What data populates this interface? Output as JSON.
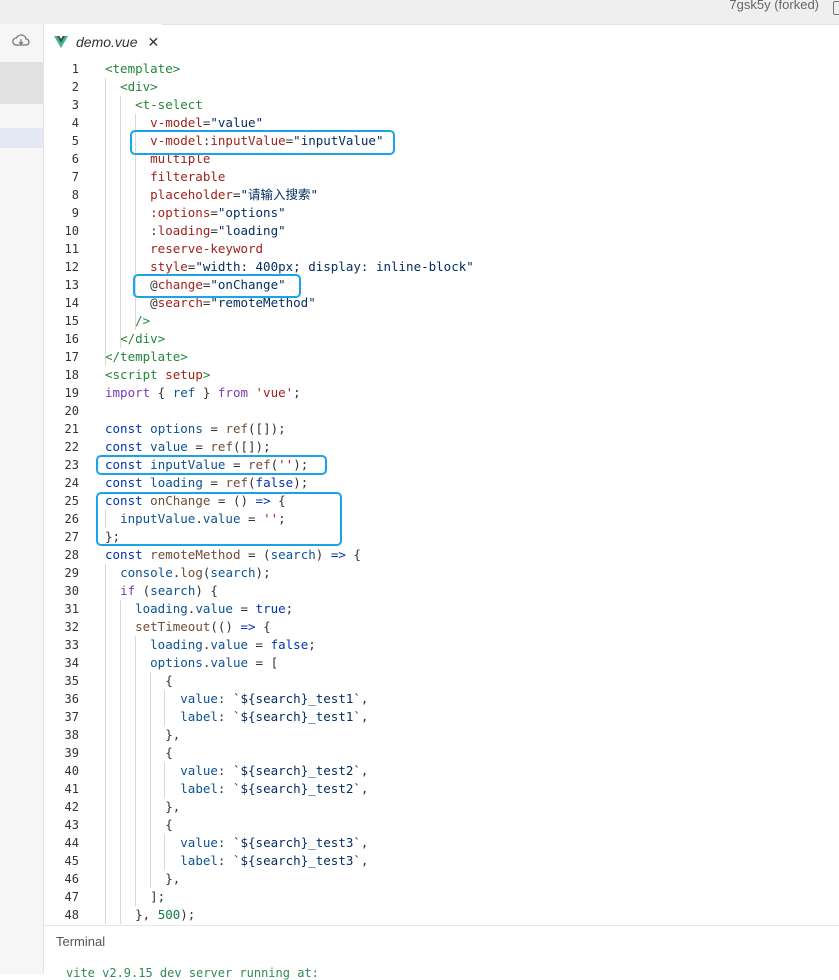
{
  "window": {
    "title": "7gsk5y (forked)"
  },
  "sidebar": {
    "sync_icon": "cloud-sync-icon"
  },
  "tab": {
    "label": "demo.vue",
    "close_label": "✕",
    "icon": "vue-logo-icon"
  },
  "editor": {
    "lines": [
      [
        {
          "t": "<template>",
          "c": "t-tag"
        }
      ],
      [
        {
          "t": "  "
        },
        {
          "t": "<div>",
          "c": "t-tag"
        }
      ],
      [
        {
          "t": "    "
        },
        {
          "t": "<t-select",
          "c": "t-tag"
        }
      ],
      [
        {
          "t": "      "
        },
        {
          "t": "v-model",
          "c": "t-attr"
        },
        {
          "t": "="
        },
        {
          "t": "\"value\"",
          "c": "t-str"
        }
      ],
      [
        {
          "t": "      "
        },
        {
          "t": "v-model",
          "c": "t-attr"
        },
        {
          "t": ":"
        },
        {
          "t": "inputValue",
          "c": "t-attr"
        },
        {
          "t": "="
        },
        {
          "t": "\"inputValue\"",
          "c": "t-str"
        }
      ],
      [
        {
          "t": "      "
        },
        {
          "t": "multiple",
          "c": "t-attr"
        }
      ],
      [
        {
          "t": "      "
        },
        {
          "t": "filterable",
          "c": "t-attr"
        }
      ],
      [
        {
          "t": "      "
        },
        {
          "t": "placeholder",
          "c": "t-attr"
        },
        {
          "t": "="
        },
        {
          "t": "\"请输入搜索\"",
          "c": "t-str"
        }
      ],
      [
        {
          "t": "      "
        },
        {
          "t": ":options",
          "c": "t-attr"
        },
        {
          "t": "="
        },
        {
          "t": "\"options\"",
          "c": "t-str"
        }
      ],
      [
        {
          "t": "      "
        },
        {
          "t": ":"
        },
        {
          "t": "loading",
          "c": "t-attr"
        },
        {
          "t": "="
        },
        {
          "t": "\"loading\"",
          "c": "t-str"
        }
      ],
      [
        {
          "t": "      "
        },
        {
          "t": "reserve-keyword",
          "c": "t-attr"
        }
      ],
      [
        {
          "t": "      "
        },
        {
          "t": "style",
          "c": "t-attr"
        },
        {
          "t": "="
        },
        {
          "t": "\"width: 400px; display: inline-block\"",
          "c": "t-str"
        }
      ],
      [
        {
          "t": "      "
        },
        {
          "t": "@"
        },
        {
          "t": "change",
          "c": "t-attr"
        },
        {
          "t": "="
        },
        {
          "t": "\"onChange\"",
          "c": "t-str"
        }
      ],
      [
        {
          "t": "      "
        },
        {
          "t": "@"
        },
        {
          "t": "search",
          "c": "t-attr"
        },
        {
          "t": "="
        },
        {
          "t": "\"remoteMethod\"",
          "c": "t-str"
        }
      ],
      [
        {
          "t": "    "
        },
        {
          "t": "/>",
          "c": "t-tag"
        }
      ],
      [
        {
          "t": "  "
        },
        {
          "t": "</div>",
          "c": "t-tag"
        }
      ],
      [
        {
          "t": "</template>",
          "c": "t-tag"
        }
      ],
      [
        {
          "t": "<script",
          "c": "t-tag"
        },
        {
          "t": " "
        },
        {
          "t": "setup",
          "c": "t-attr"
        },
        {
          "t": ">",
          "c": "t-tag"
        }
      ],
      [
        {
          "t": "import",
          "c": "t-kw2"
        },
        {
          "t": " { "
        },
        {
          "t": "ref",
          "c": "t-var"
        },
        {
          "t": " } "
        },
        {
          "t": "from",
          "c": "t-kw2"
        },
        {
          "t": " "
        },
        {
          "t": "'vue'",
          "c": "t-attr"
        },
        {
          "t": ";"
        }
      ],
      [],
      [
        {
          "t": "const",
          "c": "t-kw"
        },
        {
          "t": " "
        },
        {
          "t": "options",
          "c": "t-var"
        },
        {
          "t": " = "
        },
        {
          "t": "ref",
          "c": "t-fn"
        },
        {
          "t": "([]);"
        }
      ],
      [
        {
          "t": "const",
          "c": "t-kw"
        },
        {
          "t": " "
        },
        {
          "t": "value",
          "c": "t-var"
        },
        {
          "t": " = "
        },
        {
          "t": "ref",
          "c": "t-fn"
        },
        {
          "t": "([]);"
        }
      ],
      [
        {
          "t": "const",
          "c": "t-kw"
        },
        {
          "t": " "
        },
        {
          "t": "inputValue",
          "c": "t-var"
        },
        {
          "t": " = "
        },
        {
          "t": "ref",
          "c": "t-fn"
        },
        {
          "t": "("
        },
        {
          "t": "''",
          "c": "t-attr"
        },
        {
          "t": ");"
        }
      ],
      [
        {
          "t": "const",
          "c": "t-kw"
        },
        {
          "t": " "
        },
        {
          "t": "loading",
          "c": "t-var"
        },
        {
          "t": " = "
        },
        {
          "t": "ref",
          "c": "t-fn"
        },
        {
          "t": "("
        },
        {
          "t": "false",
          "c": "t-kw"
        },
        {
          "t": ");"
        }
      ],
      [
        {
          "t": "const",
          "c": "t-kw"
        },
        {
          "t": " "
        },
        {
          "t": "onChange",
          "c": "t-fn"
        },
        {
          "t": " = () "
        },
        {
          "t": "=>",
          "c": "t-kw"
        },
        {
          "t": " {"
        }
      ],
      [
        {
          "t": "  "
        },
        {
          "t": "inputValue",
          "c": "t-var"
        },
        {
          "t": "."
        },
        {
          "t": "value",
          "c": "t-var"
        },
        {
          "t": " = "
        },
        {
          "t": "''",
          "c": "t-attr"
        },
        {
          "t": ";"
        }
      ],
      [
        {
          "t": "};"
        }
      ],
      [
        {
          "t": "const",
          "c": "t-kw"
        },
        {
          "t": " "
        },
        {
          "t": "remoteMethod",
          "c": "t-fn"
        },
        {
          "t": " = ("
        },
        {
          "t": "search",
          "c": "t-var"
        },
        {
          "t": ") "
        },
        {
          "t": "=>",
          "c": "t-kw"
        },
        {
          "t": " {"
        }
      ],
      [
        {
          "t": "  "
        },
        {
          "t": "console",
          "c": "t-var"
        },
        {
          "t": "."
        },
        {
          "t": "log",
          "c": "t-fn"
        },
        {
          "t": "("
        },
        {
          "t": "search",
          "c": "t-var"
        },
        {
          "t": ");"
        }
      ],
      [
        {
          "t": "  "
        },
        {
          "t": "if",
          "c": "t-kw2"
        },
        {
          "t": " ("
        },
        {
          "t": "search",
          "c": "t-var"
        },
        {
          "t": ") {"
        }
      ],
      [
        {
          "t": "    "
        },
        {
          "t": "loading",
          "c": "t-var"
        },
        {
          "t": "."
        },
        {
          "t": "value",
          "c": "t-var"
        },
        {
          "t": " = "
        },
        {
          "t": "true",
          "c": "t-kw"
        },
        {
          "t": ";"
        }
      ],
      [
        {
          "t": "    "
        },
        {
          "t": "setTimeout",
          "c": "t-fn"
        },
        {
          "t": "(() "
        },
        {
          "t": "=>",
          "c": "t-kw"
        },
        {
          "t": " {"
        }
      ],
      [
        {
          "t": "      "
        },
        {
          "t": "loading",
          "c": "t-var"
        },
        {
          "t": "."
        },
        {
          "t": "value",
          "c": "t-var"
        },
        {
          "t": " = "
        },
        {
          "t": "false",
          "c": "t-kw"
        },
        {
          "t": ";"
        }
      ],
      [
        {
          "t": "      "
        },
        {
          "t": "options",
          "c": "t-var"
        },
        {
          "t": "."
        },
        {
          "t": "value",
          "c": "t-var"
        },
        {
          "t": " = ["
        }
      ],
      [
        {
          "t": "        {"
        }
      ],
      [
        {
          "t": "          "
        },
        {
          "t": "value",
          "c": "t-var"
        },
        {
          "t": ": "
        },
        {
          "t": "`${search}_test1`",
          "c": "t-str"
        },
        {
          "t": ","
        }
      ],
      [
        {
          "t": "          "
        },
        {
          "t": "label",
          "c": "t-var"
        },
        {
          "t": ": "
        },
        {
          "t": "`${search}_test1`",
          "c": "t-str"
        },
        {
          "t": ","
        }
      ],
      [
        {
          "t": "        },"
        }
      ],
      [
        {
          "t": "        {"
        }
      ],
      [
        {
          "t": "          "
        },
        {
          "t": "value",
          "c": "t-var"
        },
        {
          "t": ": "
        },
        {
          "t": "`${search}_test2`",
          "c": "t-str"
        },
        {
          "t": ","
        }
      ],
      [
        {
          "t": "          "
        },
        {
          "t": "label",
          "c": "t-var"
        },
        {
          "t": ": "
        },
        {
          "t": "`${search}_test2`",
          "c": "t-str"
        },
        {
          "t": ","
        }
      ],
      [
        {
          "t": "        },"
        }
      ],
      [
        {
          "t": "        {"
        }
      ],
      [
        {
          "t": "          "
        },
        {
          "t": "value",
          "c": "t-var"
        },
        {
          "t": ": "
        },
        {
          "t": "`${search}_test3`",
          "c": "t-str"
        },
        {
          "t": ","
        }
      ],
      [
        {
          "t": "          "
        },
        {
          "t": "label",
          "c": "t-var"
        },
        {
          "t": ": "
        },
        {
          "t": "`${search}_test3`",
          "c": "t-str"
        },
        {
          "t": ","
        }
      ],
      [
        {
          "t": "        },"
        }
      ],
      [
        {
          "t": "      ];"
        }
      ],
      [
        {
          "t": "    }, "
        },
        {
          "t": "500",
          "c": "t-num"
        },
        {
          "t": ");"
        }
      ]
    ]
  },
  "terminal": {
    "title": "Terminal",
    "output": "vite v2.9.15 dev server running at:"
  },
  "colors": {
    "highlight": "#1aa3e8",
    "tag": "#22863a",
    "attr": "#a0221a",
    "string": "#032f62"
  }
}
